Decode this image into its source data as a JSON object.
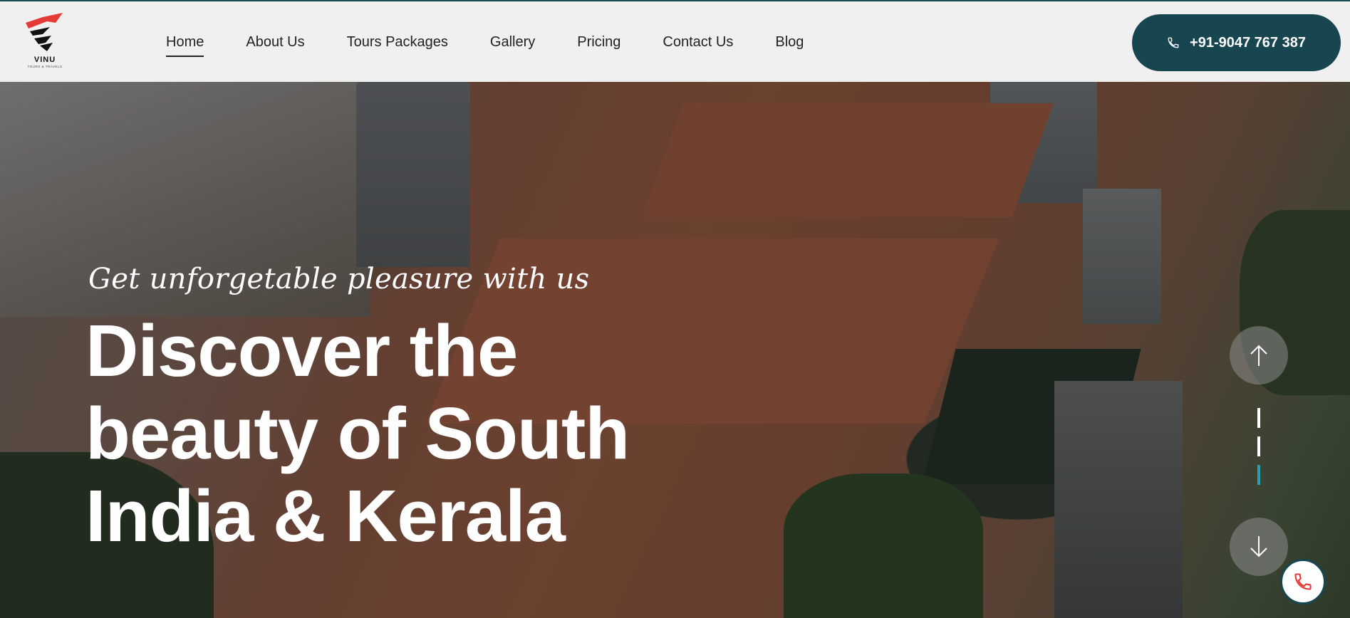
{
  "brand": {
    "name": "VINU",
    "tagline": "TOURS & TRAVELS",
    "colors": {
      "primary": "#174550",
      "accent": "#e53935"
    }
  },
  "nav": {
    "items": [
      {
        "label": "Home",
        "active": true
      },
      {
        "label": "About Us"
      },
      {
        "label": "Tours Packages"
      },
      {
        "label": "Gallery"
      },
      {
        "label": "Pricing"
      },
      {
        "label": "Contact Us"
      },
      {
        "label": "Blog"
      }
    ]
  },
  "header": {
    "phone_label": "+91-9047 767 387",
    "phone_icon": "phone-icon"
  },
  "hero": {
    "tagline": "Get unforgetable pleasure with us",
    "headline_lines": [
      "Discover the",
      "beauty of South",
      "India & Kerala"
    ],
    "slider": {
      "up_icon": "arrow-up-icon",
      "down_icon": "arrow-down-icon",
      "active_index": 2
    }
  },
  "floating": {
    "call_icon": "phone-icon"
  }
}
